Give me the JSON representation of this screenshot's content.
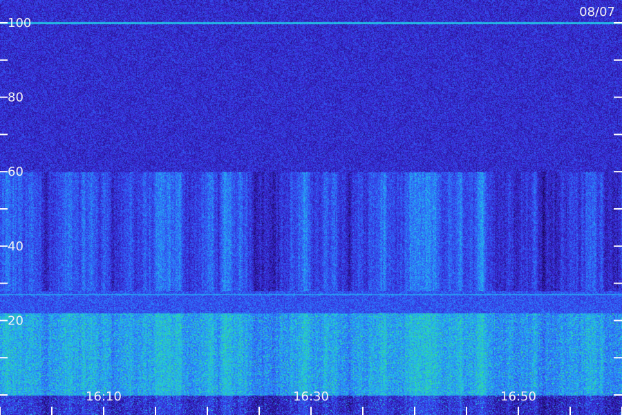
{
  "chart_data": {
    "type": "heatmap",
    "title": "",
    "xlabel": "",
    "ylabel": "",
    "date": "08/07",
    "y_ticks_labeled": [
      20,
      40,
      60,
      80,
      100
    ],
    "y_ticks_minor": [
      0,
      10,
      30,
      50,
      70,
      90
    ],
    "ylim": [
      0,
      100
    ],
    "x_ticks_labeled": [
      "16:10",
      "16:30",
      "16:50"
    ],
    "x_ticks_minor": [
      "16:00",
      "16:05",
      "16:15",
      "16:20",
      "16:25",
      "16:35",
      "16:40",
      "16:45",
      "16:55",
      "17:00"
    ],
    "x_range": [
      "16:00",
      "17:00"
    ],
    "grid": false,
    "colormap": [
      "#14084e",
      "#3a1fcc",
      "#2f6bff",
      "#22c7e6",
      "#39e07a"
    ],
    "intensity_bands": [
      {
        "from": 0,
        "to": 22,
        "level": 0.85
      },
      {
        "from": 22,
        "to": 28,
        "level": 0.45
      },
      {
        "from": 28,
        "to": 60,
        "level": 0.4
      },
      {
        "from": 60,
        "to": 100,
        "level": 0.2
      }
    ],
    "lines": [
      {
        "at": 100,
        "level": 0.65
      },
      {
        "at": 27,
        "level": 0.55
      }
    ]
  }
}
